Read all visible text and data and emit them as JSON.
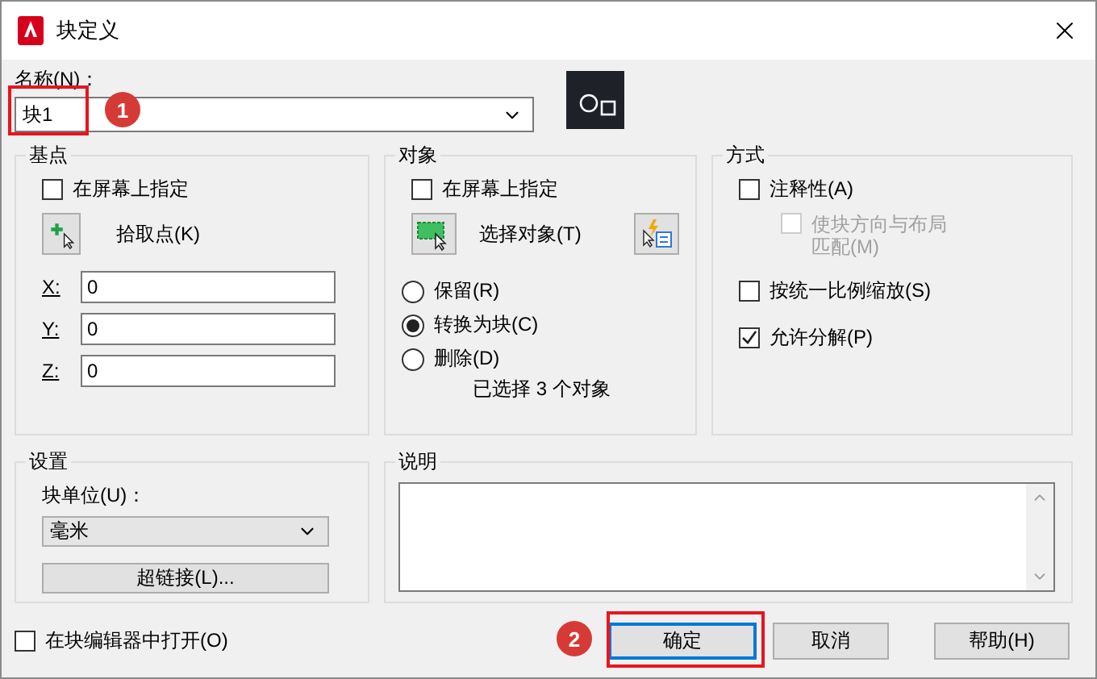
{
  "window": {
    "title": "块定义"
  },
  "name": {
    "label": "名称(N)：",
    "value": "块1"
  },
  "base_point": {
    "title": "基点",
    "specify_on_screen": {
      "label": "在屏幕上指定",
      "checked": false
    },
    "pick_button": "拾取点(K)",
    "coords": [
      {
        "label": "X:",
        "value": "0"
      },
      {
        "label": "Y:",
        "value": "0"
      },
      {
        "label": "Z:",
        "value": "0"
      }
    ]
  },
  "objects": {
    "title": "对象",
    "specify_on_screen": {
      "label": "在屏幕上指定",
      "checked": false
    },
    "select_button": "选择对象(T)",
    "options": [
      {
        "label": "保留(R)",
        "selected": false
      },
      {
        "label": "转换为块(C)",
        "selected": true
      },
      {
        "label": "删除(D)",
        "selected": false
      }
    ],
    "status": "已选择 3 个对象"
  },
  "behavior": {
    "title": "方式",
    "options": [
      {
        "label": "注释性(A)",
        "checked": false,
        "disabled": false,
        "children": [
          {
            "label": "使块方向与布局匹配(M)",
            "checked": false,
            "disabled": true
          }
        ]
      },
      {
        "label": "按统一比例缩放(S)",
        "checked": false,
        "disabled": false
      },
      {
        "label": "允许分解(P)",
        "checked": true,
        "disabled": false
      }
    ]
  },
  "settings": {
    "title": "设置",
    "unit_label": "块单位(U)：",
    "unit_value": "毫米",
    "hyperlink_button": "超链接(L)..."
  },
  "description": {
    "title": "说明"
  },
  "open_in_editor": {
    "label": "在块编辑器中打开(O)",
    "checked": false
  },
  "buttons": [
    {
      "label": "确定",
      "default": true
    },
    {
      "label": "取消",
      "default": false
    },
    {
      "label": "帮助(H)",
      "default": false
    }
  ],
  "annotations": [
    {
      "number": "1"
    },
    {
      "number": "2"
    }
  ]
}
